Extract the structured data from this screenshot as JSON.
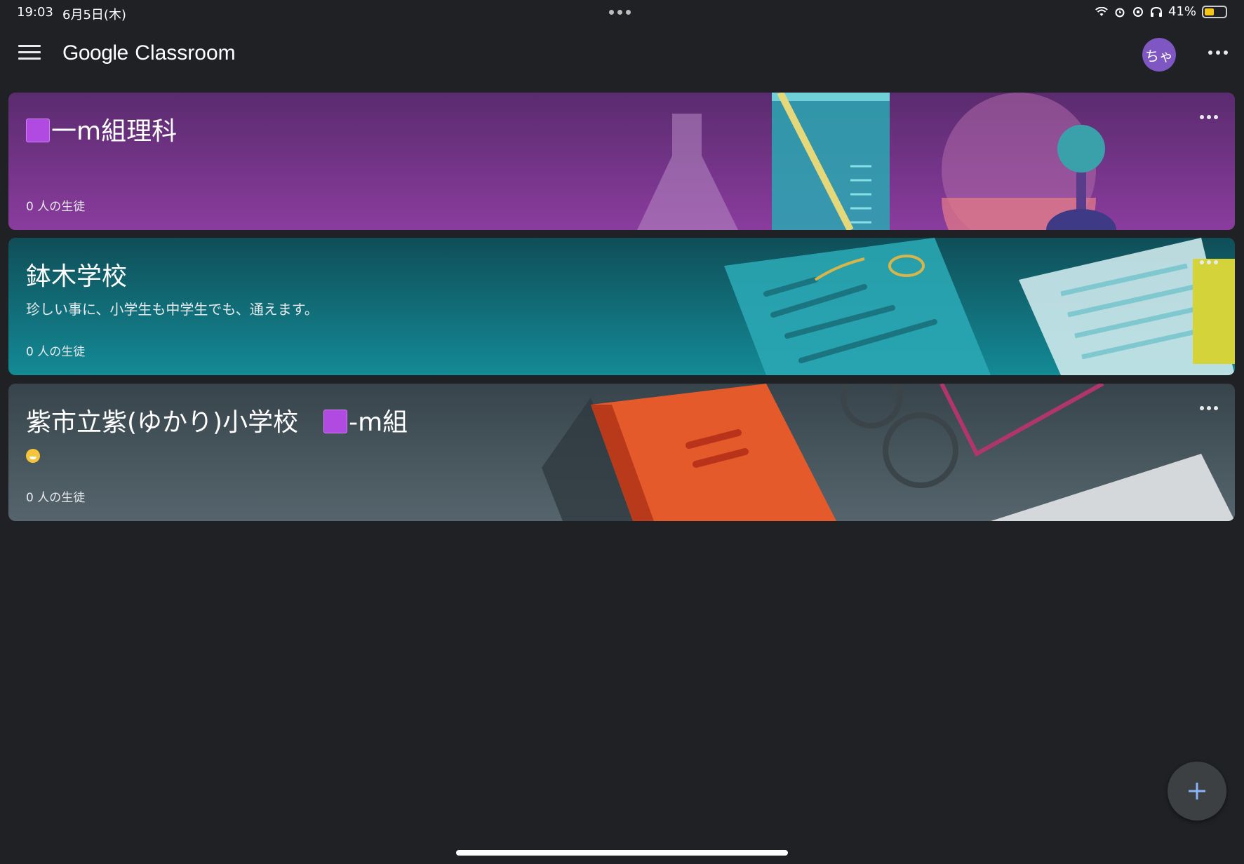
{
  "status_bar": {
    "time": "19:03",
    "date": "6月5日(木)",
    "battery": "41%"
  },
  "app": {
    "brand_google": "Google",
    "brand_classroom": "Classroom",
    "avatar_text": "ちゃ"
  },
  "classes": [
    {
      "title": "一m組理科",
      "subtitle": "",
      "students": "0 人の生徒",
      "theme": "#7b3a91"
    },
    {
      "title": "鉢木学校",
      "subtitle": "珍しい事に、小学生も中学生でも、通えます。",
      "students": "0 人の生徒",
      "theme": "#0f6e7a"
    },
    {
      "title_main": "紫市立紫(ゆかり)小学校",
      "title_suffix": "-m組",
      "subtitle": "",
      "students": "0 人の生徒",
      "theme": "#455a64"
    }
  ],
  "colors": {
    "background": "#202124",
    "accent": "#8ab4f8",
    "avatar": "#7e57c2"
  }
}
